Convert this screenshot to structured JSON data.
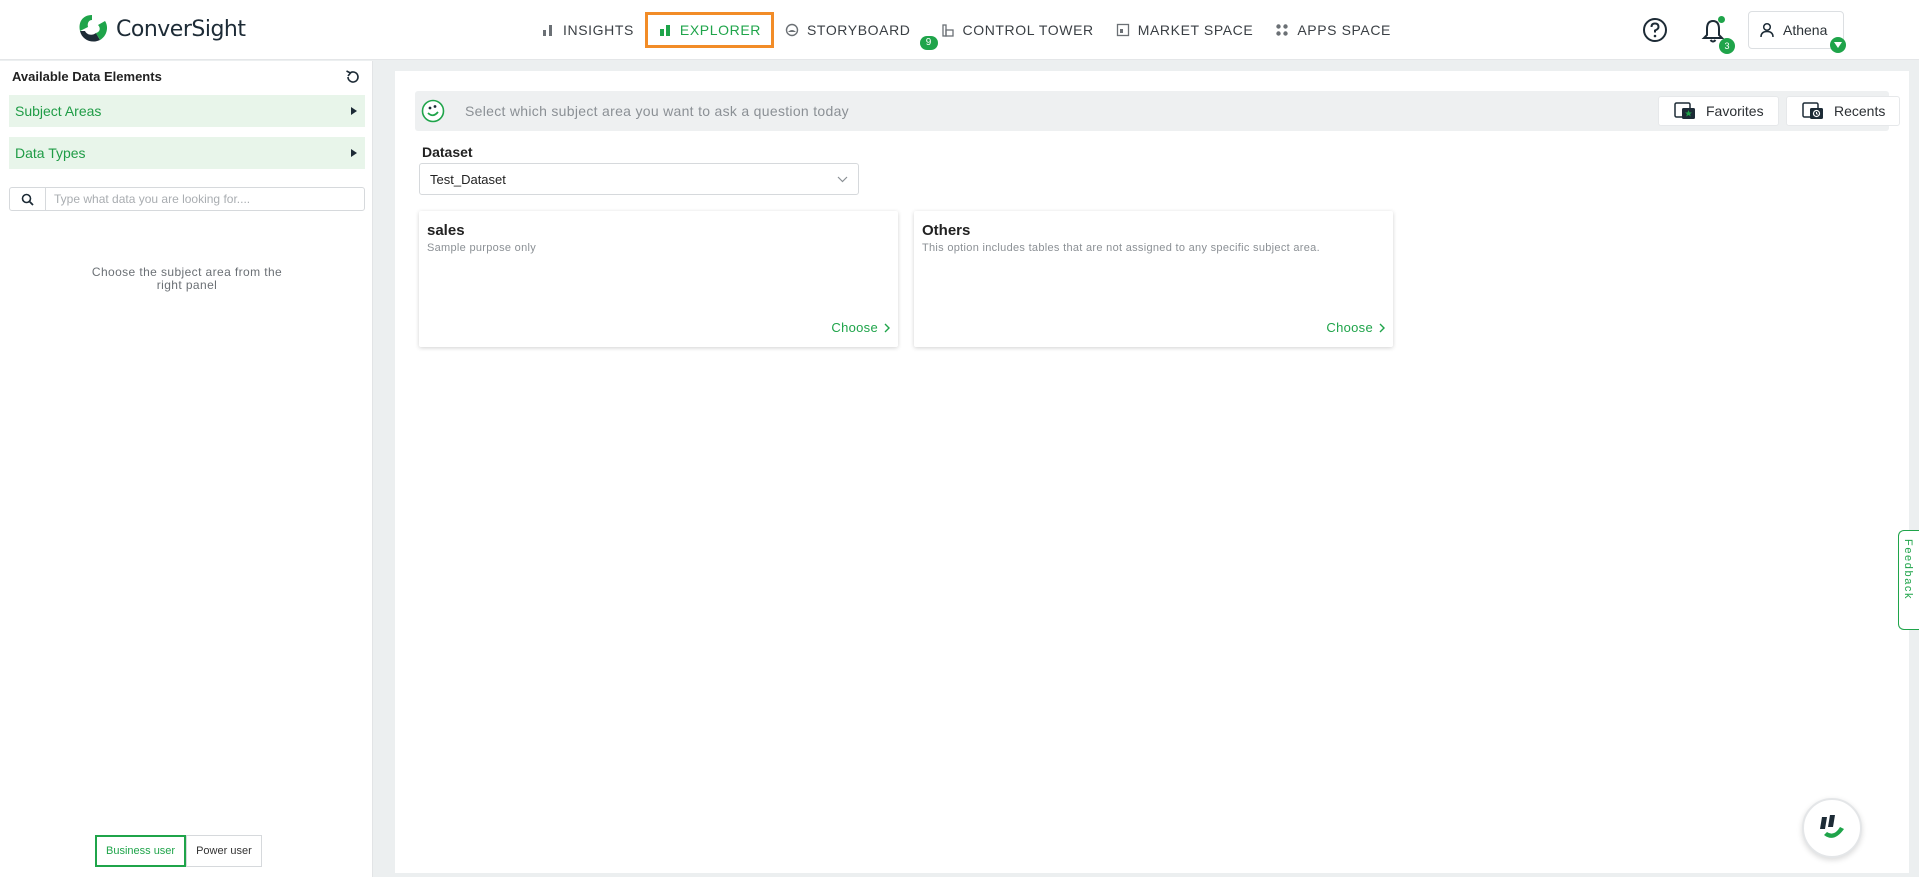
{
  "brand": {
    "name": "ConverSight",
    "primary_color": "#1fa44a",
    "highlight_color": "#f28c28"
  },
  "nav": {
    "items": [
      {
        "label": "INSIGHTS",
        "icon": "bar-chart-icon"
      },
      {
        "label": "EXPLORER",
        "icon": "explorer-icon",
        "active": true
      },
      {
        "label": "STORYBOARD",
        "icon": "storyboard-icon",
        "badge": "9"
      },
      {
        "label": "CONTROL TOWER",
        "icon": "control-tower-icon"
      },
      {
        "label": "MARKET SPACE",
        "icon": "market-space-icon"
      },
      {
        "label": "APPS SPACE",
        "icon": "apps-space-icon"
      }
    ]
  },
  "header": {
    "help_icon": "help-icon",
    "notifications": {
      "icon": "bell-icon",
      "count": "3"
    },
    "user": {
      "name": "Athena",
      "icon": "user-icon"
    }
  },
  "sidebar": {
    "title": "Available Data Elements",
    "sections": [
      {
        "label": "Subject Areas"
      },
      {
        "label": "Data Types"
      }
    ],
    "search": {
      "placeholder": "Type what data you are looking for....",
      "value": ""
    },
    "hint": "Choose the subject area from the right panel",
    "modes": [
      {
        "label": "Business user",
        "active": true
      },
      {
        "label": "Power user",
        "active": false
      }
    ]
  },
  "main": {
    "ask_prompt": "Select which subject area you want to ask a question today",
    "favorites_label": "Favorites",
    "recents_label": "Recents",
    "dataset_label": "Dataset",
    "dataset_value": "Test_Dataset",
    "cards": [
      {
        "title": "sales",
        "description": "Sample purpose only",
        "action": "Choose"
      },
      {
        "title": "Others",
        "description": "This option includes tables that are not assigned to any specific subject area.",
        "action": "Choose"
      }
    ]
  },
  "feedback_label": "Feedback"
}
